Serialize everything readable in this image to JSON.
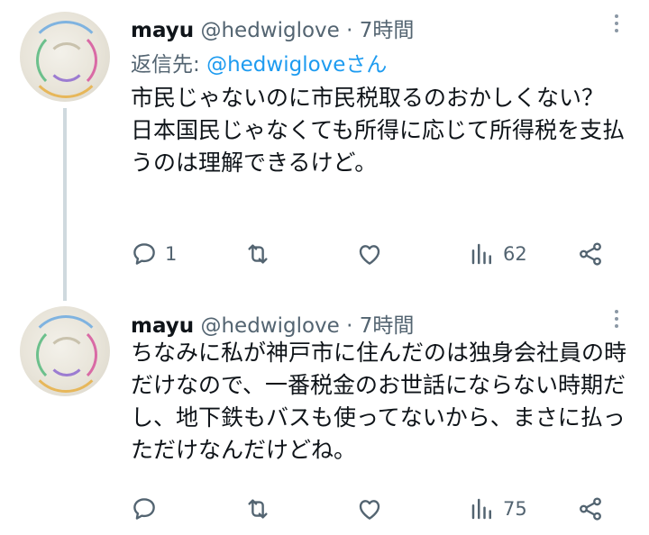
{
  "tweets": [
    {
      "name": "mayu",
      "handle": "@hedwiglove",
      "separator": "·",
      "time": "7時間",
      "reply_prefix": "返信先: ",
      "reply_mention": "@hedwigloveさん",
      "text": "市民じゃないのに市民税取るのおかしくない？\n日本国民じゃなくても所得に応じて所得税を支払うのは理解できるけど。",
      "replies": "1",
      "retweets": "",
      "likes": "",
      "views": "62"
    },
    {
      "name": "mayu",
      "handle": "@hedwiglove",
      "separator": "·",
      "time": "7時間",
      "text": "ちなみに私が神戸市に住んだのは独身会社員の時だけなので、一番税金のお世話にならない時期だし、地下鉄もバスも使ってないから、まさに払っただけなんだけどね。",
      "replies": "",
      "retweets": "",
      "likes": "",
      "views": "75"
    }
  ],
  "icons": {
    "reply": "speech-bubble-icon",
    "retweet": "retweet-arrows-icon",
    "like": "heart-outline-icon",
    "views": "bar-chart-icon",
    "share": "share-nodes-icon",
    "more": "vertical-dots-icon"
  },
  "colors": {
    "text": "#0f1419",
    "muted": "#536471",
    "link": "#1d9bf0",
    "thread_line": "#cfd9de"
  }
}
